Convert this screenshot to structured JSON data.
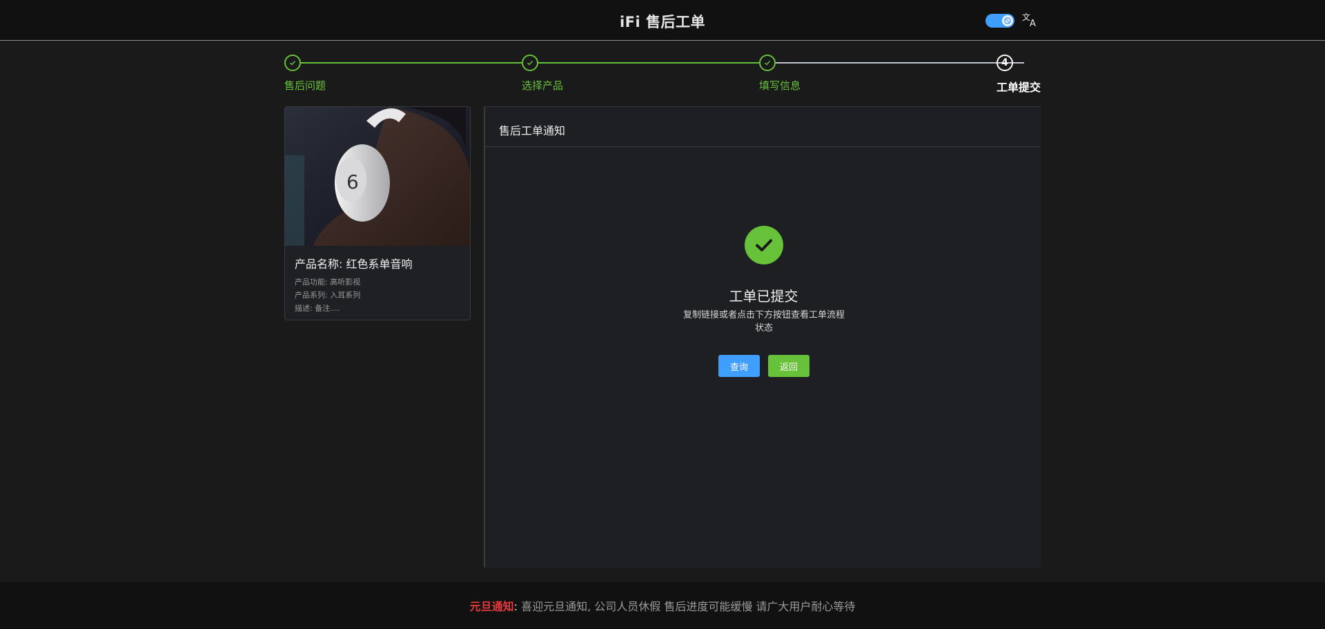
{
  "header": {
    "title": "iFi 售后工单",
    "theme_toggle_icon": "moon-icon",
    "translate_icon": "translate-icon"
  },
  "steps": [
    {
      "label": "售后问题",
      "status": "finished"
    },
    {
      "label": "选择产品",
      "status": "finished"
    },
    {
      "label": "填写信息",
      "status": "finished"
    },
    {
      "label": "工单提交",
      "status": "current",
      "number": "4"
    }
  ],
  "product": {
    "name": "产品名称: 红色系单音响",
    "function": "产品功能: 高听影视",
    "series": "产品系列: 入耳系列",
    "description": "描述: 备注...."
  },
  "notice": {
    "header": "售后工单通知",
    "result_title": "工单已提交",
    "result_subtitle": "复制链接或者点击下方按钮查看工单流程状态",
    "query_label": "查询",
    "back_label": "返回"
  },
  "footer": {
    "tag": "元旦通知",
    "separator": ":",
    "text": " 喜迎元旦通知, 公司人员休假 售后进度可能缓慢 请广大用户耐心等待"
  },
  "colors": {
    "success": "#67c23a",
    "primary": "#409eff",
    "notice_red": "#e6393f",
    "background": "#1a1a1a"
  }
}
